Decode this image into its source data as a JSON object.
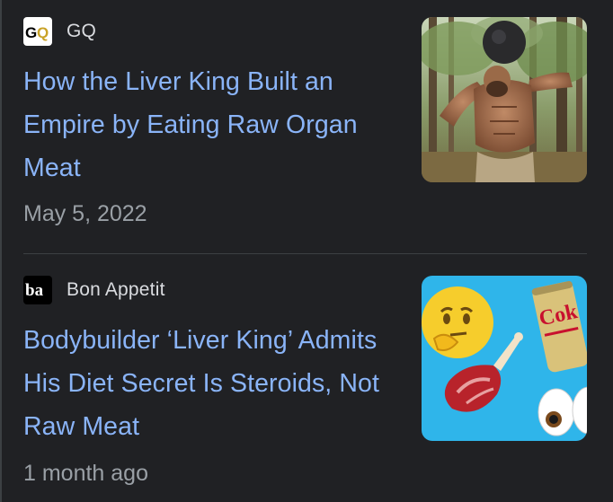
{
  "articles": [
    {
      "source": "GQ",
      "logo_icon": "gq-logo-icon",
      "headline": "How the Liver King Built an Empire by Eating Raw Organ Meat",
      "date": "May 5, 2022",
      "thumbnail": "muscular-man-lifting-kettlebell-in-forest"
    },
    {
      "source": "Bon Appetit",
      "logo_icon": "bon-appetit-logo-icon",
      "headline": "Bodybuilder ‘Liver King’ Admits His Diet Secret Is Steroids, Not Raw Meat",
      "date": "1 month ago",
      "thumbnail": "thinking-emoji-steak-coke-can-eyes-illustration"
    }
  ],
  "colors": {
    "background": "#202124",
    "headline": "#8ab4f8",
    "source": "#dadce0",
    "date": "#9aa0a6",
    "divider": "#3c4043"
  }
}
